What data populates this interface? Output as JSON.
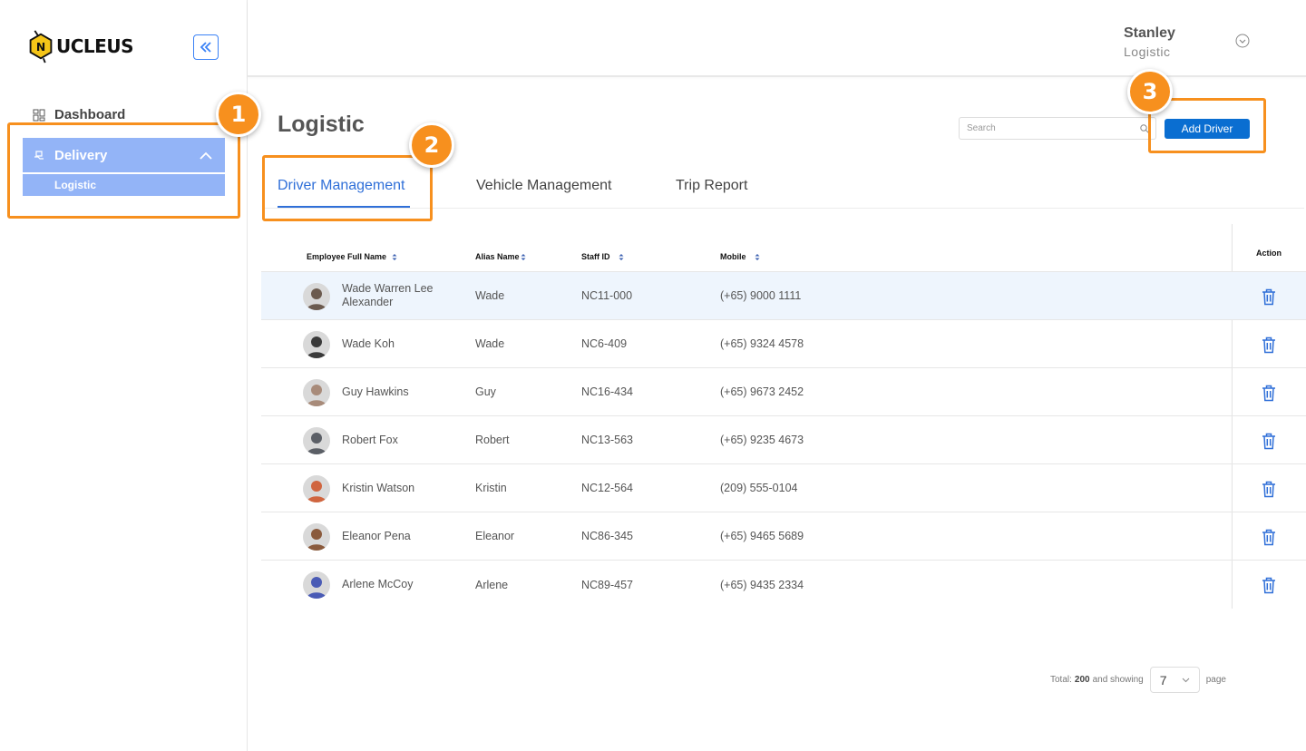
{
  "brand": {
    "logo_text": "UCLEUS",
    "logo_letter": "N"
  },
  "sidebar": {
    "dashboard_label": "Dashboard",
    "delivery_label": "Delivery",
    "delivery_sub_label": "Logistic"
  },
  "header": {
    "user_name": "Stanley",
    "user_role": "Logistic"
  },
  "page": {
    "title": "Logistic",
    "search_placeholder": "Search",
    "add_button_label": "Add Driver"
  },
  "tabs": [
    {
      "label": "Driver Management",
      "active": true
    },
    {
      "label": "Vehicle Management",
      "active": false
    },
    {
      "label": "Trip Report",
      "active": false
    }
  ],
  "table": {
    "columns": {
      "name": "Employee Full Name",
      "alias": "Alias Name",
      "staff_id": "Staff ID",
      "mobile": "Mobile",
      "action": "Action"
    },
    "rows": [
      {
        "name": "Wade Warren Lee Alexander",
        "alias": "Wade",
        "staff_id": "NC11-000",
        "mobile": "(+65) 9000 1111",
        "avatar_color": "#6b5a4e"
      },
      {
        "name": "Wade Koh",
        "alias": "Wade",
        "staff_id": "NC6-409",
        "mobile": "(+65) 9324 4578",
        "avatar_color": "#3a3a3a"
      },
      {
        "name": "Guy Hawkins",
        "alias": "Guy",
        "staff_id": "NC16-434",
        "mobile": "(+65) 9673 2452",
        "avatar_color": "#a88b7a"
      },
      {
        "name": "Robert Fox",
        "alias": "Robert",
        "staff_id": "NC13-563",
        "mobile": "(+65) 9235 4673",
        "avatar_color": "#5b5f66"
      },
      {
        "name": "Kristin Watson",
        "alias": "Kristin",
        "staff_id": "NC12-564",
        "mobile": "(209) 555-0104",
        "avatar_color": "#d0653f"
      },
      {
        "name": "Eleanor Pena",
        "alias": "Eleanor",
        "staff_id": "NC86-345",
        "mobile": "(+65) 9465 5689",
        "avatar_color": "#8a5a3c"
      },
      {
        "name": "Arlene McCoy",
        "alias": "Arlene",
        "staff_id": "NC89-457",
        "mobile": "(+65) 9435 2334",
        "avatar_color": "#4a5bb5"
      }
    ]
  },
  "pagination": {
    "total_prefix": "Total:",
    "total": "200",
    "showing_text": "and showing",
    "page_size": "7",
    "suffix": "page"
  },
  "annotations": {
    "badge_1": "1",
    "badge_2": "2",
    "badge_3": "3",
    "color": "#f7901e"
  },
  "colors": {
    "primary": "#0a6ed1",
    "active_tab": "#2f6fd8",
    "sidebar_active": "#93b4f7",
    "row_highlight": "#eef5fd"
  }
}
